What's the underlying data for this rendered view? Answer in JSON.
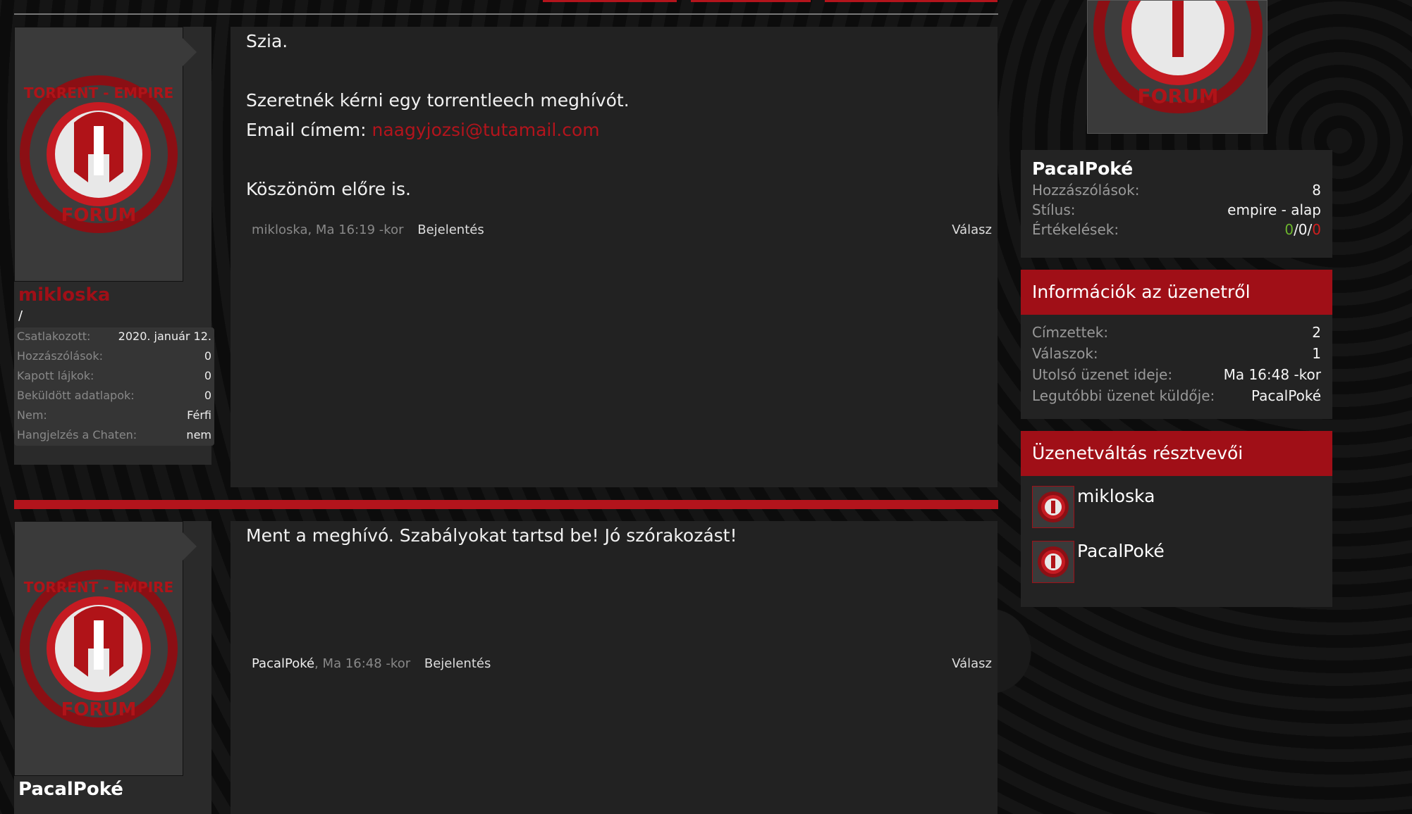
{
  "posts": [
    {
      "author": "mikloska",
      "title": "/",
      "stats": [
        {
          "label": "Csatlakozott:",
          "value": "2020. január 12."
        },
        {
          "label": "Hozzászólások:",
          "value": "0"
        },
        {
          "label": "Kapott lájkok:",
          "value": "0"
        },
        {
          "label": "Beküldött adatlapok:",
          "value": "0"
        },
        {
          "label": "Nem:",
          "value": "Férfi"
        },
        {
          "label": "Hangjelzés a Chaten:",
          "value": "nem"
        }
      ],
      "lines": [
        "Szia.",
        "Szeretnék kérni egy torrentleech meghívót."
      ],
      "email_prefix": "Email címem: ",
      "email": "naagyjozsi@tutamail.com",
      "closing": "Köszönöm előre is.",
      "meta": "mikloska, Ma 16:19 -kor",
      "report": "Bejelentés",
      "reply": "Válasz"
    },
    {
      "author": "PacalPoké",
      "text": "Ment a meghívó. Szabályokat tartsd be! Jó szórakozást!",
      "meta_author": "PacalPoké",
      "meta_time": ", Ma 16:48 -kor",
      "report": "Bejelentés",
      "reply": "Válasz"
    }
  ],
  "sidebar": {
    "profile": {
      "name": "PacalPoké",
      "rows": [
        {
          "label": "Hozzászólások:",
          "value": "8"
        },
        {
          "label": "Stílus:",
          "value": "empire - alap"
        }
      ],
      "rating_label": "Értékelések:",
      "rating_pos": "0",
      "rating_neu": "/0/",
      "rating_neg": "0"
    },
    "info": {
      "title": "Információk az üzenetről",
      "rows": [
        {
          "label": "Címzettek:",
          "value": "2"
        },
        {
          "label": "Válaszok:",
          "value": "1"
        },
        {
          "label": "Utolsó üzenet ideje:",
          "value": "Ma 16:48 -kor"
        },
        {
          "label": "Legutóbbi üzenet küldője:",
          "value": "PacalPoké"
        }
      ]
    },
    "participants": {
      "title": "Üzenetváltás résztvevői",
      "users": [
        "mikloska",
        "PacalPoké"
      ]
    }
  },
  "logo_text": {
    "top": "TORRENT - EMPIRE",
    "bottom": "FORUM"
  },
  "colors": {
    "accent": "#b3141c",
    "header": "#a00f17",
    "positive": "#6cb52d",
    "negative": "#d01e1e"
  }
}
